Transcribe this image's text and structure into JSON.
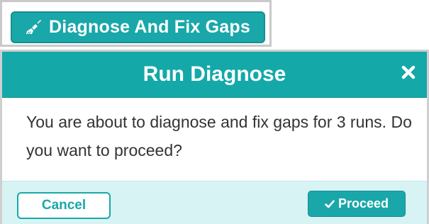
{
  "toolbar": {
    "diagnose_button_label": "Diagnose And Fix Gaps",
    "diagnose_button_icon": "broom-icon"
  },
  "dialog": {
    "title": "Run Diagnose",
    "close_icon": "close-icon",
    "message": "You are about to diagnose and fix gaps for 3 runs. Do you want to proceed?",
    "cancel_label": "Cancel",
    "proceed_label": "Proceed",
    "proceed_icon": "checkmark-icon"
  },
  "colors": {
    "accent": "#1aa7a9",
    "header_bg": "#14a8a9",
    "footer_bg": "#d7f3f4",
    "text": "#333333",
    "frame": "#cfcfcf"
  }
}
